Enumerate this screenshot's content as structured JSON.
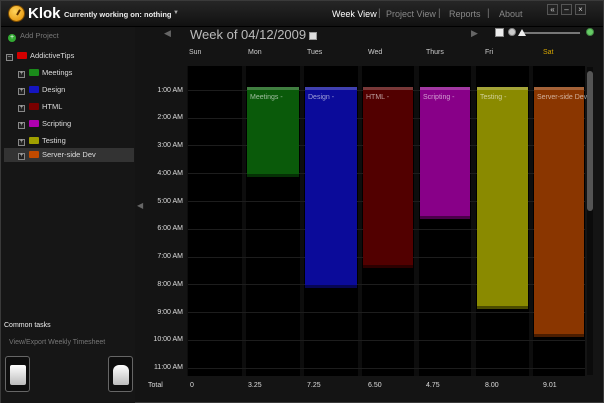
{
  "app": {
    "title": "Klok",
    "working_label": "Currently working on: nothing"
  },
  "nav": {
    "week_view": "Week View",
    "project_view": "Project View",
    "reports": "Reports",
    "about": "About",
    "separator": "|"
  },
  "window_buttons": [
    "«",
    "–",
    "×"
  ],
  "sidebar": {
    "add_project": "Add Project",
    "root": {
      "label": "AddictiveTips",
      "color": "#d40000",
      "expander": "–"
    },
    "items": [
      {
        "label": "Meetings",
        "color": "#1a8a1a",
        "expander": "+"
      },
      {
        "label": "Design",
        "color": "#1515c0",
        "expander": "+"
      },
      {
        "label": "HTML",
        "color": "#7a0000",
        "expander": "+"
      },
      {
        "label": "Scripting",
        "color": "#b000b0",
        "expander": "+"
      },
      {
        "label": "Testing",
        "color": "#a0a000",
        "expander": "+"
      },
      {
        "label": "Server-side Dev",
        "color": "#c04a00",
        "expander": "+"
      }
    ],
    "common_tasks": "Common tasks",
    "export_link": "View/Export Weekly Timesheet"
  },
  "calendar": {
    "week_label": "Week of  04/12/2009",
    "prev_arrow": "◀",
    "next_arrow": "▶",
    "days": [
      "Sun",
      "Mon",
      "Tues",
      "Wed",
      "Thurs",
      "Fri",
      "Sat"
    ],
    "times": [
      "1:00 AM",
      "2:00 AM",
      "3:00 AM",
      "4:00 AM",
      "5:00 AM",
      "6:00 AM",
      "7:00 AM",
      "8:00 AM",
      "9:00 AM",
      "10:00 AM",
      "11:00 AM"
    ],
    "entries": [
      {
        "day": "Mon",
        "label": "Meetings -",
        "color": "#0a5a0a",
        "start_hour": 0.75,
        "end_hour": 4.0
      },
      {
        "day": "Tues",
        "label": "Design -",
        "color": "#0b0b9a",
        "start_hour": 0.75,
        "end_hour": 8.0
      },
      {
        "day": "Wed",
        "label": "HTML -",
        "color": "#520000",
        "start_hour": 0.75,
        "end_hour": 7.25
      },
      {
        "day": "Thurs",
        "label": "Scripting -",
        "color": "#880088",
        "start_hour": 0.75,
        "end_hour": 5.5
      },
      {
        "day": "Fri",
        "label": "Testing -",
        "color": "#8a8a00",
        "start_hour": 0.75,
        "end_hour": 8.75
      },
      {
        "day": "Sat",
        "label": "Server-side Dev",
        "color": "#8a3600",
        "start_hour": 0.75,
        "end_hour": 9.75
      }
    ],
    "total_label": "Total",
    "totals": [
      "0",
      "3.25",
      "7.25",
      "6.50",
      "4.75",
      "8.00",
      "9.01"
    ]
  }
}
